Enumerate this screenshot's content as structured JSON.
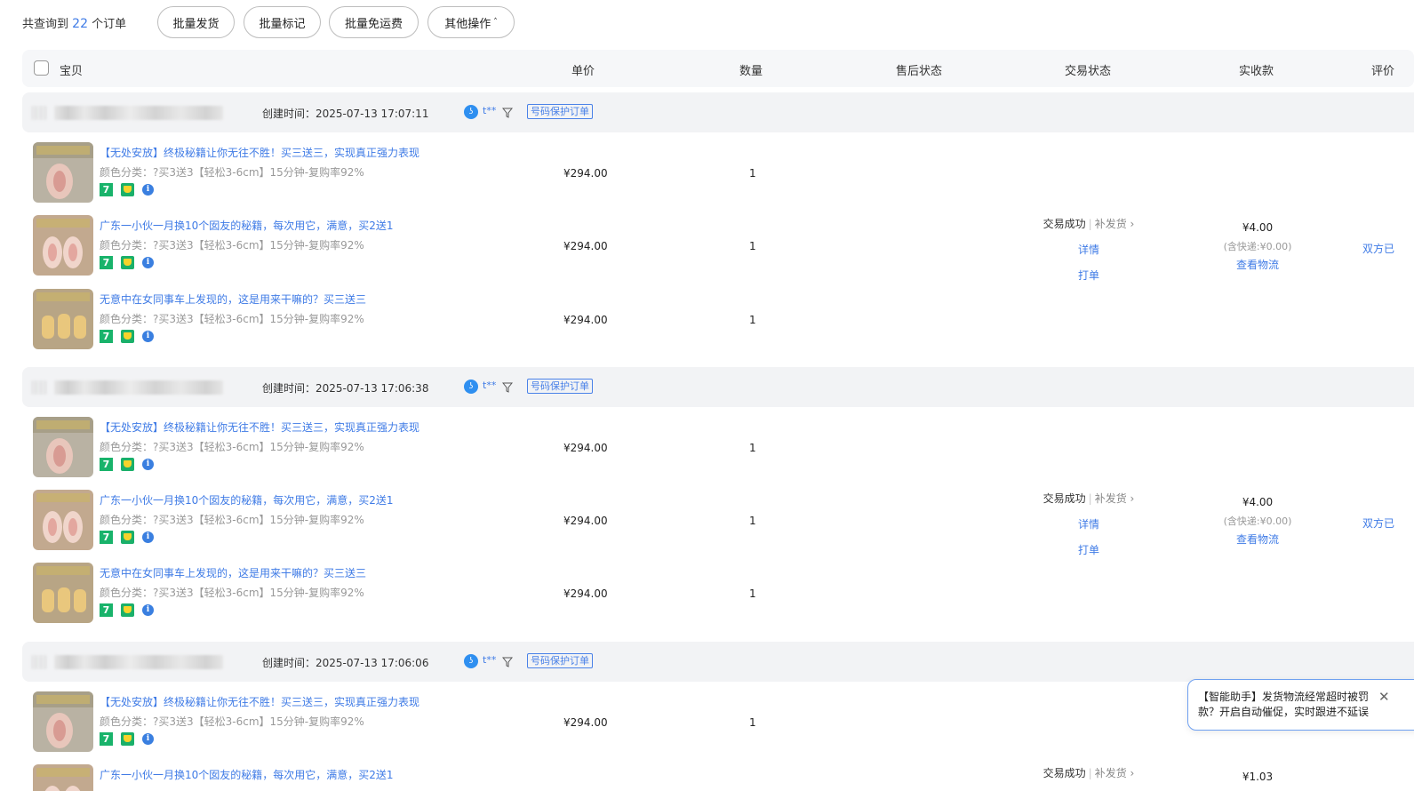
{
  "toolbar": {
    "count_prefix": "共查询到",
    "count_value": "22",
    "count_suffix": "个订单",
    "batch_ship": "批量发货",
    "batch_mark": "批量标记",
    "batch_free_shipping": "批量免运费",
    "more_actions": "其他操作",
    "more_caret": "˄"
  },
  "table_header": {
    "item": "宝贝",
    "unit_price": "单价",
    "quantity": "数量",
    "after_sale": "售后状态",
    "trade_status": "交易状态",
    "paid": "实收款",
    "evaluation": "评价"
  },
  "orders": [
    {
      "created": "创建时间：2025-07-13 17:07:11",
      "buyer": "t**",
      "protect_tag": "号码保护订单",
      "status": "交易成功",
      "reship": "补发货",
      "reship_arrow": "›",
      "detail": "详情",
      "print": "打单",
      "paid": "¥4.00",
      "shipping": "(含快递:¥0.00)",
      "logistics": "查看物流",
      "evaluation": "双方已"
    },
    {
      "created": "创建时间：2025-07-13 17:06:38",
      "buyer": "t**",
      "protect_tag": "号码保护订单",
      "status": "交易成功",
      "reship": "补发货",
      "reship_arrow": "›",
      "detail": "详情",
      "print": "打单",
      "paid": "¥4.00",
      "shipping": "(含快递:¥0.00)",
      "logistics": "查看物流",
      "evaluation": "双方已"
    },
    {
      "created": "创建时间：2025-07-13 17:06:06",
      "buyer": "t**",
      "protect_tag": "号码保护订单",
      "status": "交易成功",
      "reship": "补发货",
      "reship_arrow": "›",
      "paid": "¥1.03"
    }
  ],
  "products": [
    {
      "title": "【无处安放】终极秘籍让你无往不胜！买三送三，实现真正强力表现",
      "sku": "颜色分类：?买3送3【轻松3-6cm】15分钟-复购率92%",
      "price": "¥294.00",
      "qty": "1",
      "tag7": "7",
      "info": "i"
    },
    {
      "title": "广东一小伙一月换10个囡友的秘籍，每次用它，满意，买2送1",
      "sku": "颜色分类：?买3送3【轻松3-6cm】15分钟-复购率92%",
      "price": "¥294.00",
      "qty": "1",
      "tag7": "7",
      "info": "i"
    },
    {
      "title": "无意中在女同事车上发现的，这是用来干嘛的？买三送三",
      "sku": "颜色分类：?买3送3【轻松3-6cm】15分钟-复购率92%",
      "price": "¥294.00",
      "qty": "1",
      "tag7": "7",
      "info": "i"
    }
  ],
  "toast": {
    "text": "【智能助手】发货物流经常超时被罚款？开启自动催促，实时跟进不延误",
    "close": "✕"
  },
  "colors": {
    "link_blue": "#3f7be6",
    "header_bg": "#f6f7f9",
    "order_head_bg": "#f2f3f5",
    "tag_green": "#19b36b"
  }
}
